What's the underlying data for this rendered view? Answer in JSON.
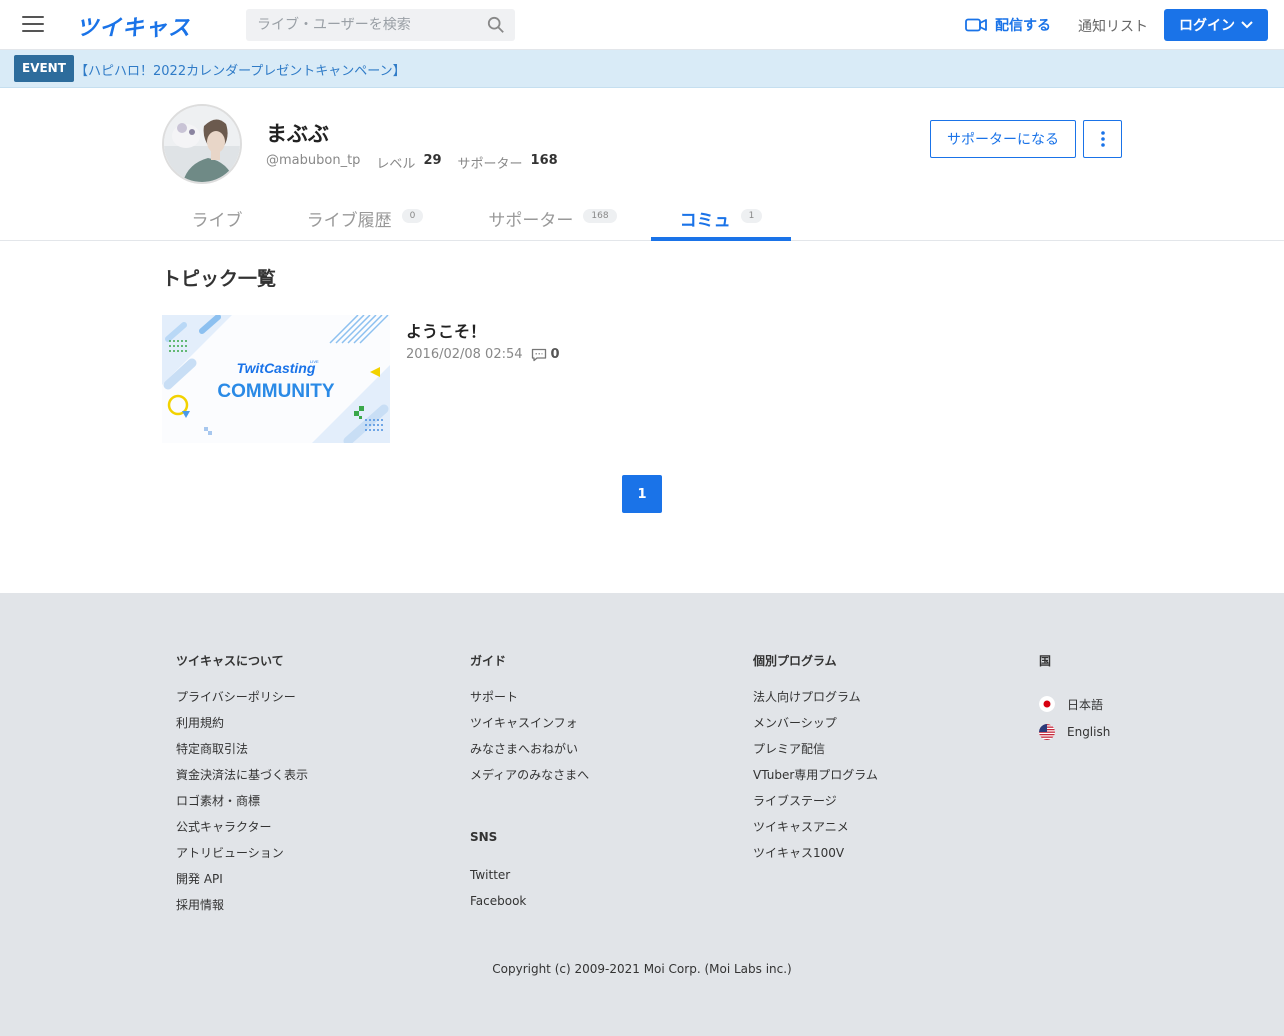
{
  "header": {
    "logo": "ツイキャス",
    "search_placeholder": "ライブ・ユーザーを検索",
    "broadcast_label": "配信する",
    "notification_label": "通知リスト",
    "login_label": "ログイン"
  },
  "event": {
    "tag": "EVENT",
    "text": "【ハピハロ！2022カレンダープレゼントキャンペーン】"
  },
  "profile": {
    "name": "まぶぶ",
    "handle": "@mabubon_tp",
    "level_label": "レベル",
    "level": "29",
    "supporter_label": "サポーター",
    "supporters": "168",
    "support_button": "サポーターになる"
  },
  "tabs": [
    {
      "label": "ライブ",
      "badge": ""
    },
    {
      "label": "ライブ履歴",
      "badge": "0"
    },
    {
      "label": "サポーター",
      "badge": "168"
    },
    {
      "label": "コミュ",
      "badge": "1",
      "active": true
    }
  ],
  "main": {
    "section_title": "トピック一覧",
    "topics": [
      {
        "title": "ようこそ！",
        "date": "2016/02/08 02:54",
        "comments": "0",
        "thumb_brand": "TwitCasting",
        "thumb_brand_sup": "LIVE",
        "thumb_title": "COMMUNITY"
      }
    ],
    "pagination": [
      "1"
    ]
  },
  "footer": {
    "columns": [
      {
        "title": "ツイキャスについて",
        "links": [
          "プライバシーポリシー",
          "利用規約",
          "特定商取引法",
          "資金決済法に基づく表示",
          "ロゴ素材・商標",
          "公式キャラクター",
          "アトリビューション",
          "開発 API",
          "採用情報"
        ]
      },
      {
        "title": "ガイド",
        "links": [
          "サポート",
          "ツイキャスインフォ",
          "みなさまへおねがい",
          "メディアのみなさまへ"
        ]
      },
      {
        "title": "SNS",
        "links": [
          "Twitter",
          "Facebook"
        ]
      },
      {
        "title": "個別プログラム",
        "links": [
          "法人向けプログラム",
          "メンバーシップ",
          "プレミア配信",
          "VTuber専用プログラム",
          "ライブステージ",
          "ツイキャスアニメ",
          "ツイキャス100V"
        ]
      },
      {
        "title": "国",
        "links": [
          "日本語",
          "English"
        ]
      }
    ],
    "copyright": "Copyright (c) 2009-2021 Moi Corp. (Moi Labs inc.)"
  },
  "colors": {
    "accent": "#1a73e8",
    "event_bg": "#d9ebf7",
    "footer_bg": "#e1e4e8"
  }
}
